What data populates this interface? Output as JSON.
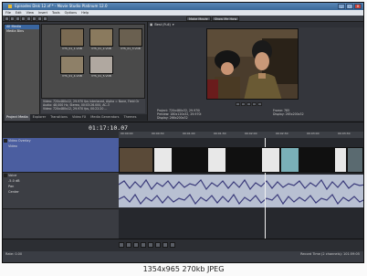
{
  "window": {
    "title": "Episodes Disk 12.vf * - Movie Studio Platinum 12.0"
  },
  "window_buttons": [
    "_",
    "□",
    "x"
  ],
  "menu": [
    "File",
    "Edit",
    "View",
    "Insert",
    "Tools",
    "Options",
    "Help"
  ],
  "toolbar": {
    "buttons": [
      "Make Movie",
      "Show Me How"
    ]
  },
  "explorer": {
    "items": [
      "All Media",
      "Media Bins"
    ]
  },
  "media_bin": {
    "clips": [
      {
        "label": "VTS_01_1.VOB",
        "color": "#7a6a52"
      },
      {
        "label": "VTS_01_2.VOB",
        "color": "#8a7a5e"
      },
      {
        "label": "VTS_01_3.VOB",
        "color": "#6a6050"
      },
      {
        "label": "VTS_01_4.VOB",
        "color": "#8e8068"
      },
      {
        "label": "VTS_01_5.VOB",
        "color": "#b0a8a0"
      }
    ],
    "properties": [
      "Video: 720x480x12, 29.970 fps interlaced, Alpha = None, Field Or",
      "Audio: 48,000 Hz, Stereo, 00:03:26.000, AC-3",
      "Video: 720x480x12, 29.970 fps, 00:22:20 ..."
    ]
  },
  "tabs_left": [
    "Project Media",
    "Explorer",
    "Transitions",
    "Video FX",
    "Media Generators",
    "Themes"
  ],
  "preview": {
    "mode": "Best (Full)",
    "project_info": "Project: 720x480x32, 29.970i\nPreview: 180x120x32, 29.970i\nDisplay: 266x200x32",
    "frame_info": "Frame: 785\nDisplay: 265x200x32"
  },
  "timeline": {
    "timecode": "01:17:10.07",
    "ruler_labels": [
      "00:00:00",
      "00:00:30",
      "00:01:00",
      "00:01:30",
      "00:02:00",
      "00:02:30",
      "00:03:00",
      "00:03:30"
    ],
    "video_track": {
      "name": "Video Overlay",
      "sub": "Video",
      "number": "1"
    },
    "audio_track": {
      "name": "Voice",
      "level": "-5.0 dB",
      "pan_label": "Pan",
      "pan_value": "Center",
      "number": "2"
    },
    "video_clips": [
      {
        "color": "#5a4a38"
      },
      {
        "color": "#e8e8e8"
      },
      {
        "color": "#101010"
      },
      {
        "color": "#e8e8e8"
      },
      {
        "color": "#101010"
      },
      {
        "color": "#e8e8e8"
      },
      {
        "color": "#7ab0b8"
      },
      {
        "color": "#101010"
      },
      {
        "color": "#e8e8e8"
      },
      {
        "color": "#5a6a70"
      }
    ]
  },
  "status": {
    "left": "Rate: 0.00",
    "right": "Record Time (2 channels): 101:59:05"
  },
  "caption": "1354x965  270kb  JPEG"
}
